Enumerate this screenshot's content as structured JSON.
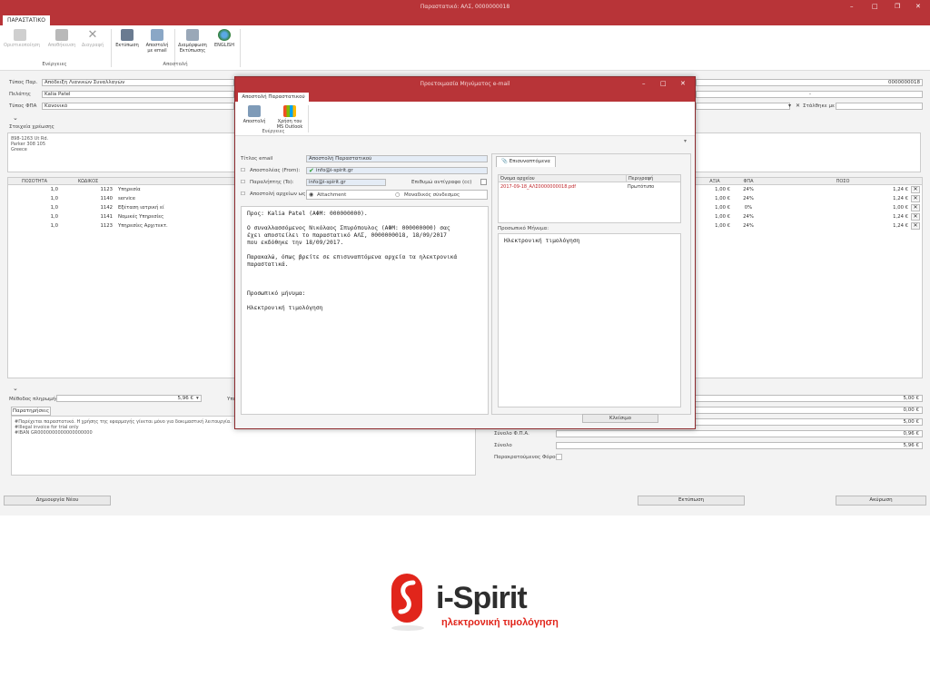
{
  "window": {
    "title": "Παραστατικό: ΑΛΣ, 0000000018"
  },
  "ribbon": {
    "tab": "ΠΑΡΑΣΤΑΤΙΚΟ",
    "buttons": {
      "oristikopoiisi": "Οριστικοποίηση",
      "apothikefsi": "Αποθήκευση",
      "diagrafi": "Διαγραφή",
      "ektyposi": "Εκτύπωση",
      "apostoli_email": "Αποστολή με email",
      "diamorfosi": "Διαμόρφωση Εκτύπωσης",
      "english": "ENGLISH"
    },
    "groups": {
      "energeies": "Ενέργειες",
      "apostoli": "Αποστολή"
    }
  },
  "form": {
    "typos_par_label": "Τύπος Παρ.",
    "typos_par_value": "Απόδειξη Λιανικών Συναλλαγών",
    "pelatis_label": "Πελάτης",
    "pelatis_value": "Kalia Patel",
    "typos_fpa_label": "Τύπος ΦΠΑ",
    "typos_fpa_value": "Κανονικό",
    "number": "0000000018",
    "dash": "-",
    "send_email_label": "Στάλθηκε με email",
    "billing_label": "Στοιχεία χρέωσης",
    "billing_lines": [
      "898-1263 Ut Rd.",
      "Parker 308 105",
      "Greece"
    ]
  },
  "grid": {
    "headers": {
      "qty": "ΠΟΣΟΤΗΤΑ",
      "code": "ΚΩΔΙΚΟΣ",
      "value": "ΑΞΙΑ",
      "vat": "ΦΠΑ",
      "amount": "ΠΟΣΟ"
    },
    "rows": [
      {
        "qty": "1,0",
        "code": "1123",
        "desc": "Υπηρεσία",
        "value": "1,00 €",
        "vat": "24%",
        "amount": "1,24 €"
      },
      {
        "qty": "1,0",
        "code": "1140",
        "desc": "service",
        "value": "1,00 €",
        "vat": "24%",
        "amount": "1,24 €"
      },
      {
        "qty": "1,0",
        "code": "1142",
        "desc": "Εξέταση ιατρική εί",
        "value": "1,00 €",
        "vat": "0%",
        "amount": "1,00 €"
      },
      {
        "qty": "1,0",
        "code": "1141",
        "desc": "Νομικές Υπηρεσίες",
        "value": "1,00 €",
        "vat": "24%",
        "amount": "1,24 €"
      },
      {
        "qty": "1,0",
        "code": "1123",
        "desc": "Υπηρεσίες Αρχιτεκτ.",
        "value": "1,00 €",
        "vat": "24%",
        "amount": "1,24 €"
      }
    ],
    "remove": "✕"
  },
  "payment": {
    "method_label": "Μέθοδος πληρωμής",
    "method_value": "",
    "amount": "5,96 €",
    "remaining_label": "Υπόλοιπο Πελ",
    "notes_tab": "Παρατηρήσεις",
    "notes_lines": [
      "#Παρέχεται παραστατικό. Η χρήσης της εφαρμογής γίνεται μόνο για δοκιμαστική λειτουργία.",
      "#Illegal invoice for trial only",
      "#IBAN GR0000000000000000000"
    ]
  },
  "totals": {
    "values": [
      "5,00 €",
      "0,00 €",
      "5,00 €",
      "0,96 €",
      "5,96 €"
    ],
    "vat_label": "Σύνολο Φ.Π.Α.",
    "total_label": "Σύνολο",
    "withheld_label": "Παρακρατούμενος Φόρος"
  },
  "bottom": {
    "new": "Δημιουργία Νέου",
    "print": "Εκτύπωση",
    "cancel": "Ακύρωση"
  },
  "dialog": {
    "title": "Προετοιμασία Μηνύματος e-mail",
    "tab": "Αποστολή Παραστατικού",
    "btn_send": "Αποστολή",
    "btn_outlook": "Χρήση του MS Outlook",
    "group": "Ενέργειες",
    "subject_label": "Τίτλος email",
    "subject_value": "Αποστολή Παραστατικού",
    "from_label": "Αποστολέας (From):",
    "from_value": "info@i-spirit.gr",
    "to_label": "Παραλήπτης (To):",
    "to_value": "info@i-spirit.gr",
    "cc_label": "Επιθυμώ αντίγραφο (cc)",
    "attach_label": "Αποστολή αρχείων ως:",
    "opt_attachment": "Attachment",
    "opt_link": "Μοναδικός σύνδεσμος",
    "body": {
      "to": "Προς: Kalia Patel (ΑΦΜ: 000000000).",
      "p1a": "Ο συναλλασσόμενος Νικόλαος Σπυρόπουλος (ΑΦΜ: 000000000) σας",
      "p1b": "έχει αποστείλει το παραστατικό ΑΛΣ, 0000000018, 18/09/2017",
      "p1c": "που εκδόθηκε την 18/09/2017.",
      "p2a": "Παρακαλώ, όπως βρείτε σε επισυναπτόμενα αρχεία τα ηλεκτρονικά",
      "p2b": "παραστατικά.",
      "p3": "Προσωπικό μήνυμα:",
      "p4": "Ηλεκτρονική τιμολόγηση"
    },
    "attachments_tab": "Επισυναπτόμενα",
    "att_col_name": "Όνομα αρχείου",
    "att_col_desc": "Περιγραφή",
    "att_file": "2017-09-18_ΑΛΣ0000000018.pdf",
    "att_desc": "Πρωτότυπο",
    "personal_label": "Προσωπικό Μήνυμα:",
    "personal_value": "Ηλεκτρονική τιμολόγηση",
    "close": "Κλείσιμο"
  },
  "logo": {
    "brand": "i-Spirit",
    "tagline": "ηλεκτρονική τιμολόγηση",
    "accent": "#e1251b"
  }
}
